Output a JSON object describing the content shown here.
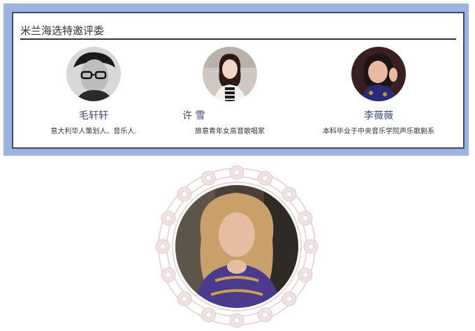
{
  "section": {
    "title": "米兰海选特邀评委"
  },
  "judges": [
    {
      "name": "毛轩轩",
      "desc": "意大利华人策划人、音乐人."
    },
    {
      "name": "许 雪",
      "desc": "旅意青年女高音歌唱家"
    },
    {
      "name": "李薇薇",
      "desc": "本科毕业于中央音乐学院声乐歌剧系"
    }
  ],
  "colors": {
    "frame": "#9cb4dd",
    "border": "#3b4a7a",
    "name_text": "#3a4a78",
    "lace": "#ead6d8"
  },
  "icons": {
    "featured_photo": "featured-judge-photo",
    "lace_frame": "lace-doily-icon"
  }
}
